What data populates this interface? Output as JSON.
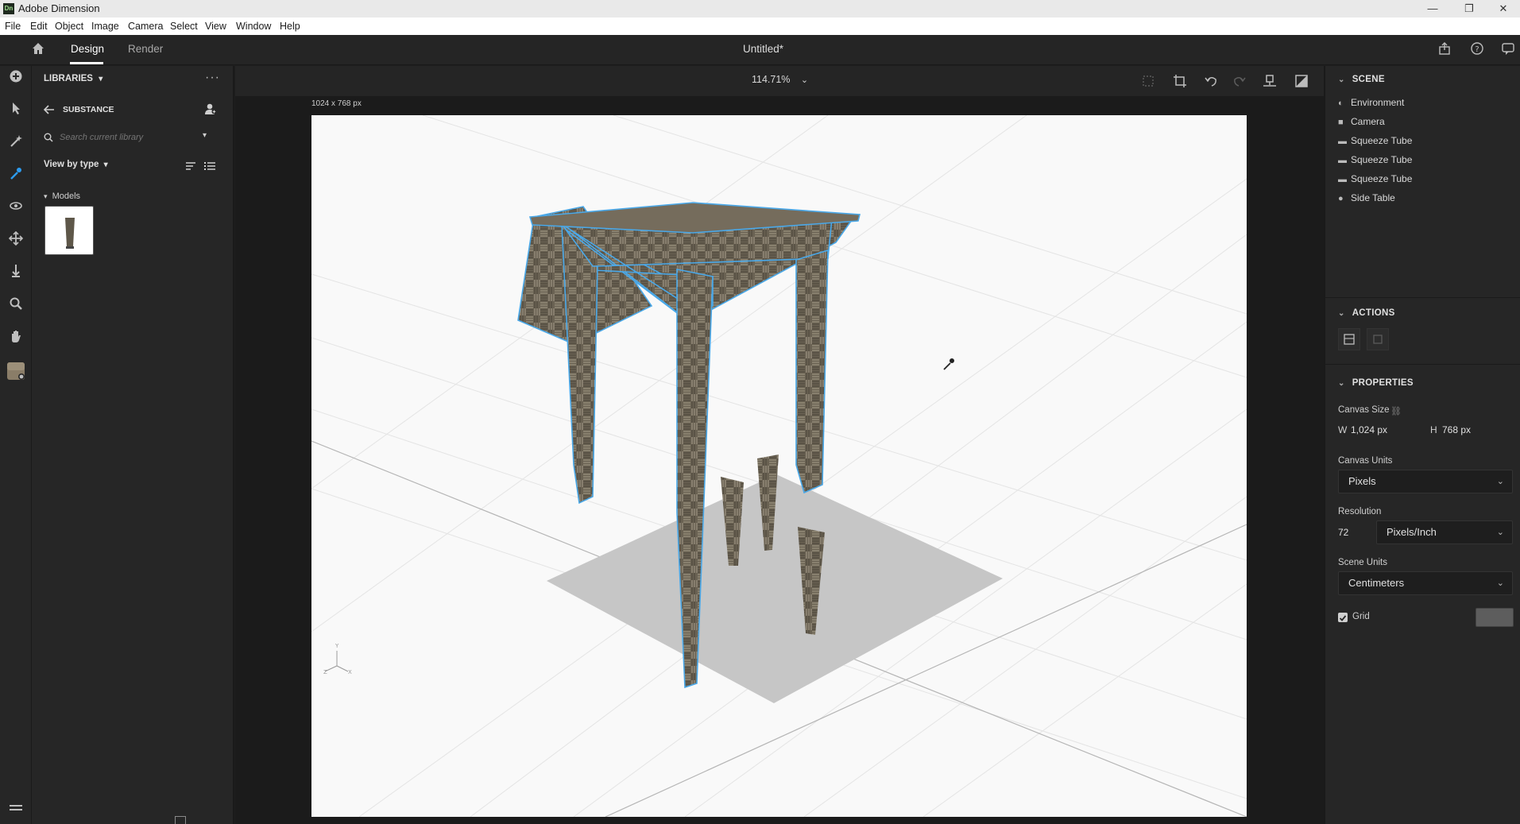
{
  "app": {
    "logo_text": "Dn",
    "title": "Adobe Dimension",
    "window_controls": [
      "—",
      "❐",
      "✕"
    ]
  },
  "menu": [
    "File",
    "Edit",
    "Object",
    "Image",
    "Camera",
    "Select",
    "View",
    "Window",
    "Help"
  ],
  "header": {
    "tabs": [
      {
        "label": "Design",
        "active": true
      },
      {
        "label": "Render",
        "active": false
      }
    ],
    "doc_title": "Untitled*"
  },
  "tools": [
    "add-icon",
    "select-icon",
    "magic-wand-icon",
    "sample-icon",
    "orbit-icon",
    "move-icon",
    "dolly-icon",
    "zoom-icon",
    "hand-icon",
    "material-swatch-icon"
  ],
  "libraries": {
    "title": "LIBRARIES",
    "more": "···",
    "library_name": "SUBSTANCE",
    "search_placeholder": "Search current library",
    "view_by": "View by type",
    "category": "Models"
  },
  "canvas": {
    "zoom": "114.71%",
    "size_label": "1024 x 768 px",
    "axis_labels": {
      "y": "Y",
      "z": "Z",
      "x": "X"
    }
  },
  "scene": {
    "title": "SCENE",
    "items": [
      {
        "label": "Environment",
        "icon": "environment-icon"
      },
      {
        "label": "Camera",
        "icon": "camera-icon"
      },
      {
        "label": "Squeeze Tube",
        "icon": "folder-icon"
      },
      {
        "label": "Squeeze Tube",
        "icon": "folder-icon"
      },
      {
        "label": "Squeeze Tube",
        "icon": "folder-icon"
      },
      {
        "label": "Side Table",
        "icon": "model-icon"
      }
    ]
  },
  "actions": {
    "title": "ACTIONS"
  },
  "properties": {
    "title": "PROPERTIES",
    "canvas_size_label": "Canvas Size",
    "w_label": "W",
    "w_value": "1,024 px",
    "h_label": "H",
    "h_value": "768 px",
    "canvas_units_label": "Canvas Units",
    "canvas_units_value": "Pixels",
    "resolution_label": "Resolution",
    "resolution_value": "72",
    "resolution_unit": "Pixels/Inch",
    "scene_units_label": "Scene Units",
    "scene_units_value": "Centimeters",
    "grid_label": "Grid",
    "grid_checked": true
  },
  "colors": {
    "accent": "#2d9cf0",
    "panel_bg": "#262626",
    "canvas_bg": "#f9f9f9"
  }
}
